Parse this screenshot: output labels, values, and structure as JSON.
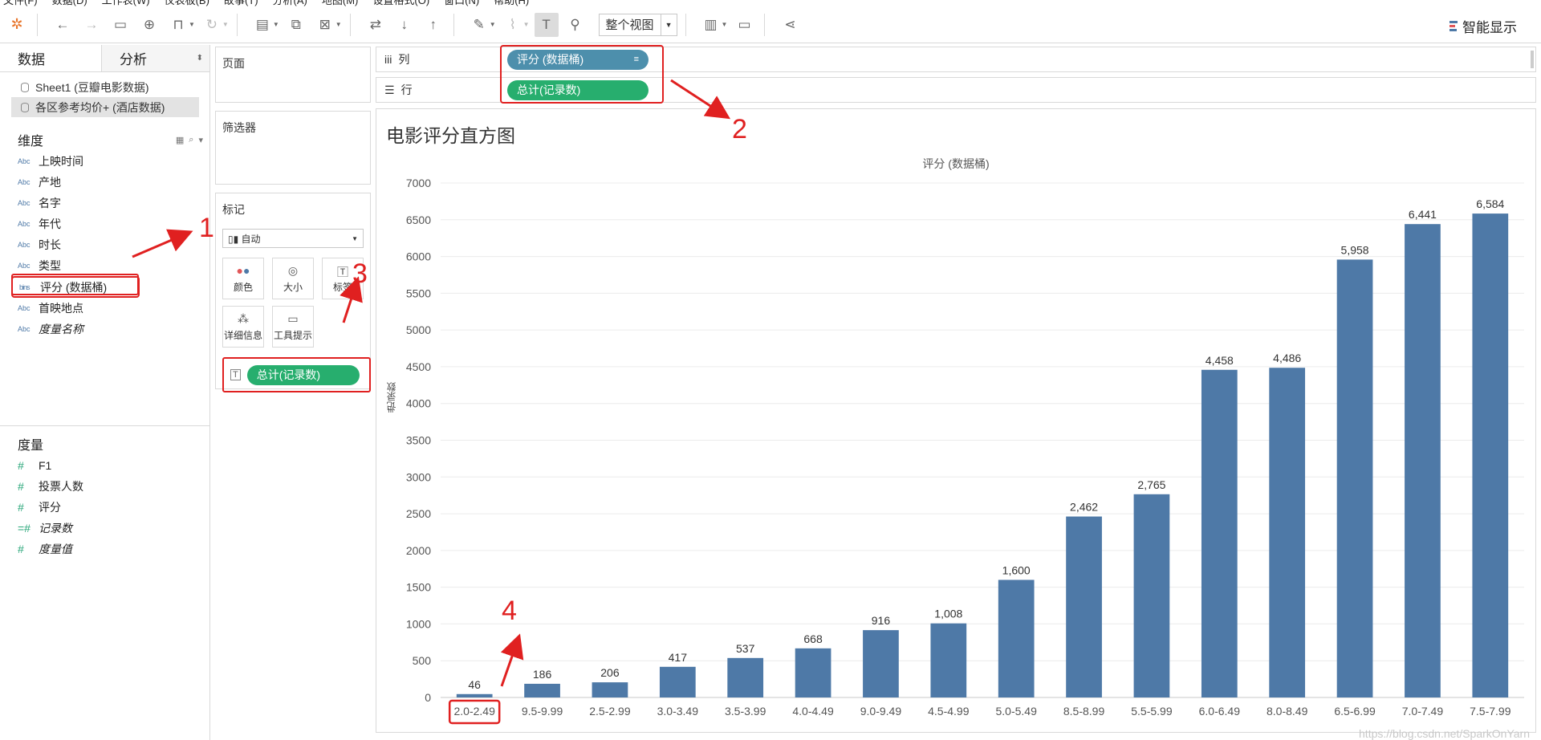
{
  "menubar": [
    "文件(F)",
    "数据(D)",
    "工作表(W)",
    "仪表板(B)",
    "故事(T)",
    "分析(A)",
    "地图(M)",
    "设置格式(O)",
    "窗口(N)",
    "帮助(H)"
  ],
  "toolbar": {
    "view_select": "整个视图",
    "smart_label": "智能显示"
  },
  "leftpanel": {
    "tabs": [
      "数据",
      "分析"
    ],
    "sources": [
      "Sheet1 (豆瓣电影数据)",
      "各区参考均价+ (酒店数据)"
    ],
    "dimensions_title": "维度",
    "dimensions": [
      {
        "icon": "Abc",
        "label": "上映时间"
      },
      {
        "icon": "Abc",
        "label": "产地"
      },
      {
        "icon": "Abc",
        "label": "名字"
      },
      {
        "icon": "Abc",
        "label": "年代"
      },
      {
        "icon": "Abc",
        "label": "时长"
      },
      {
        "icon": "Abc",
        "label": "类型"
      },
      {
        "icon": "bins",
        "label": "评分 (数据桶)"
      },
      {
        "icon": "Abc",
        "label": "首映地点"
      },
      {
        "icon": "Abc",
        "label": "度量名称"
      }
    ],
    "measures_title": "度量",
    "measures": [
      {
        "icon": "#",
        "label": "F1"
      },
      {
        "icon": "#",
        "label": "投票人数"
      },
      {
        "icon": "#",
        "label": "评分"
      },
      {
        "icon": "=#",
        "label": "记录数"
      },
      {
        "icon": "#",
        "label": "度量值"
      }
    ]
  },
  "cards": {
    "pages": "页面",
    "filters": "筛选器",
    "marks": "标记",
    "marks_type": "自动",
    "mark_buttons": [
      "颜色",
      "大小",
      "标签",
      "详细信息",
      "工具提示"
    ],
    "label_pill": "总计(记录数)"
  },
  "shelves": {
    "columns_label": "列",
    "rows_label": "行",
    "columns_pill": "评分 (数据桶)",
    "rows_pill": "总计(记录数)"
  },
  "annotations": [
    "1",
    "2",
    "3",
    "4"
  ],
  "watermark": "https://blog.csdn.net/SparkOnYarn",
  "colors": {
    "bar": "#4e79a7",
    "annotation": "#e02020",
    "green_pill": "#27ae6e",
    "blue_pill": "#4d8fac"
  },
  "chart_data": {
    "type": "bar",
    "title": "电影评分直方图",
    "xlabel": "评分 (数据桶)",
    "ylabel": "记录数",
    "categories": [
      "2.0-2.49",
      "9.5-9.99",
      "2.5-2.99",
      "3.0-3.49",
      "3.5-3.99",
      "4.0-4.49",
      "9.0-9.49",
      "4.5-4.99",
      "5.0-5.49",
      "8.5-8.99",
      "5.5-5.99",
      "6.0-6.49",
      "8.0-8.49",
      "6.5-6.99",
      "7.0-7.49",
      "7.5-7.99"
    ],
    "values": [
      46,
      186,
      206,
      417,
      537,
      668,
      916,
      1008,
      1600,
      2462,
      2765,
      4458,
      4486,
      5958,
      6441,
      6584
    ],
    "value_labels": [
      "46",
      "186",
      "206",
      "417",
      "537",
      "668",
      "916",
      "1,008",
      "1,600",
      "2,462",
      "2,765",
      "4,458",
      "4,486",
      "5,958",
      "6,441",
      "6,584"
    ],
    "ylim": [
      0,
      7000
    ],
    "yticks": [
      0,
      500,
      1000,
      1500,
      2000,
      2500,
      3000,
      3500,
      4000,
      4500,
      5000,
      5500,
      6000,
      6500,
      7000
    ],
    "grid": true,
    "legend": "none"
  }
}
